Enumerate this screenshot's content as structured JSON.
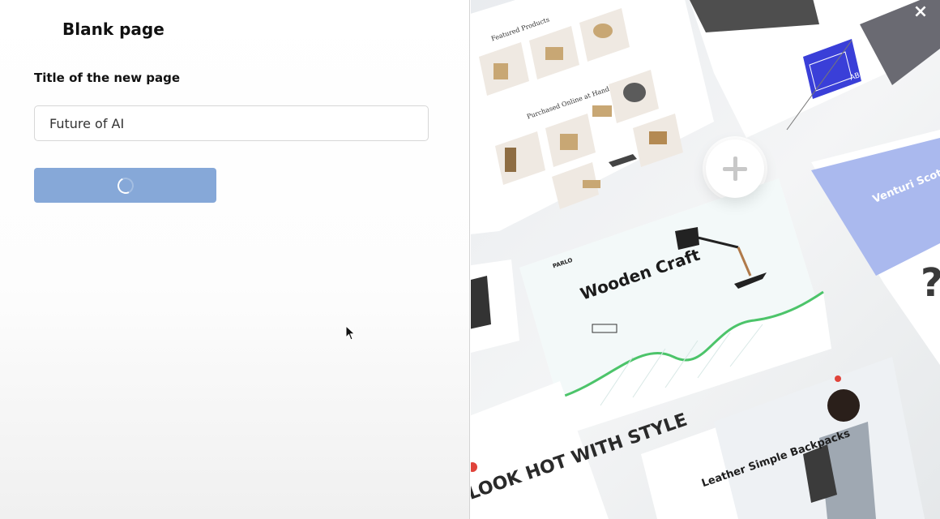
{
  "panel": {
    "heading": "Blank page",
    "field_label": "Title of the new page",
    "title_input_value": "Future of AI",
    "create_button_state": "loading"
  },
  "promo": {
    "close_icon": "×",
    "cards": {
      "shop_featured": "Featured Products",
      "shop_purchased": "Purchased Online at Hand",
      "wooden_brand": "PARLO",
      "wooden_title": "Wooden Craft",
      "venturi_title": "Venturi Scott Brown's San",
      "style_title": "LOOK HOT WITH STYLE",
      "backpacks_title": "Leather Simple Backpacks",
      "ab_tag": "AB"
    }
  },
  "colors": {
    "button_loading": "#86a8d8",
    "panel_bg": "#ffffff",
    "accent_blue": "#2f3fd6",
    "wave_green": "#4cc46a"
  }
}
